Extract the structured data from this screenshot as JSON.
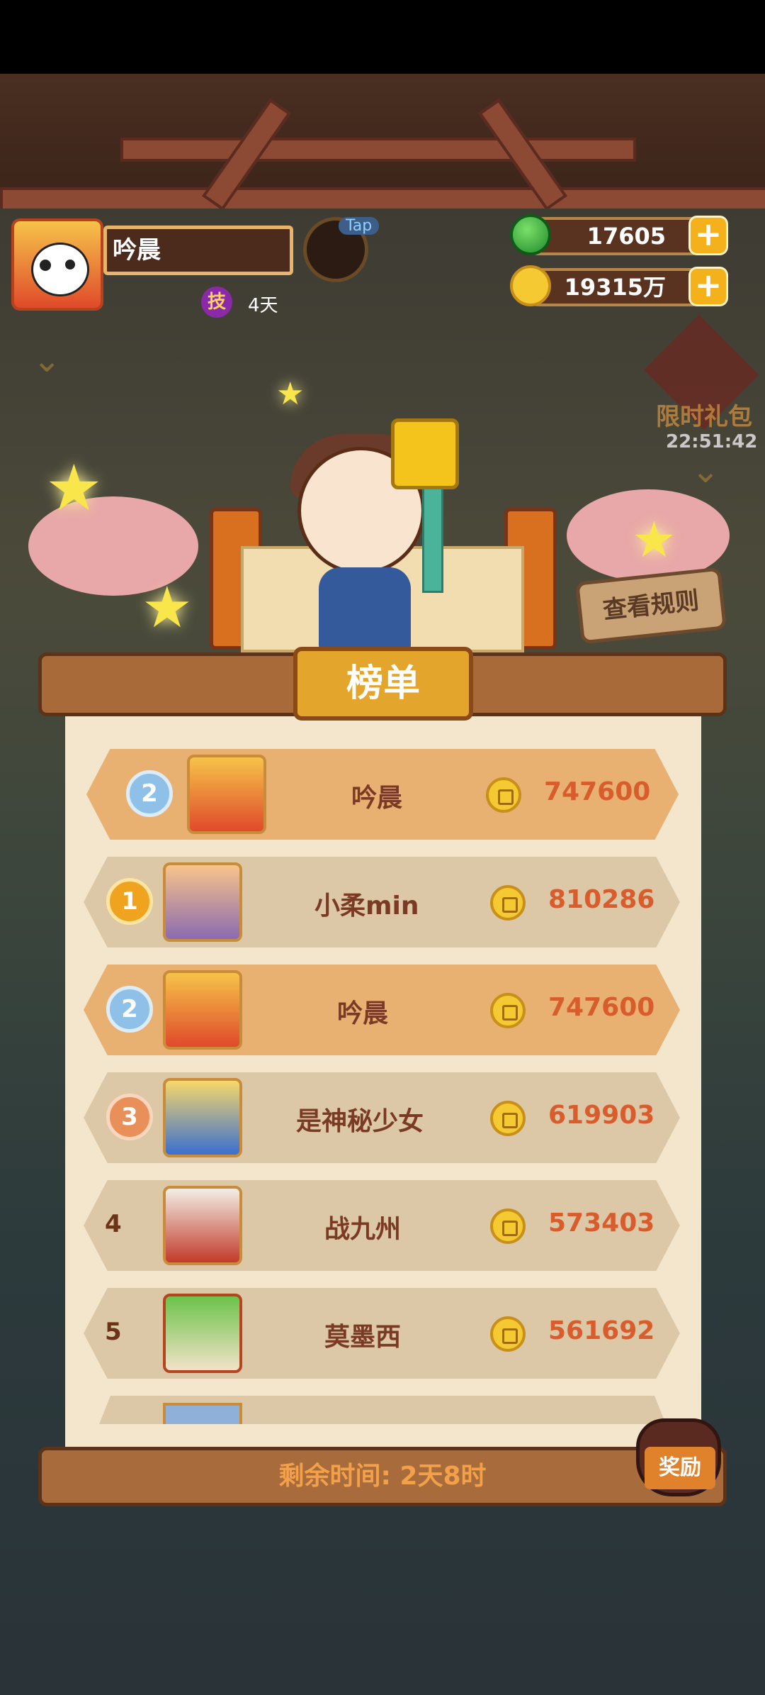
{
  "profile": {
    "name": "吟晨",
    "skill_badge": "技",
    "days": "4天",
    "tap_label": "Tap"
  },
  "currency": {
    "jade": "17605",
    "gold": "19315万",
    "plus": "+"
  },
  "gift": {
    "label": "限时礼包",
    "timer": "22:51:42"
  },
  "rules_button": "查看规则",
  "board": {
    "title": "榜单",
    "my_rank": {
      "rank": "2",
      "name": "吟晨",
      "score": "747600"
    },
    "rows": [
      {
        "rank": "1",
        "name": "小柔min",
        "score": "810286"
      },
      {
        "rank": "2",
        "name": "吟晨",
        "score": "747600"
      },
      {
        "rank": "3",
        "name": "是神秘少女",
        "score": "619903"
      },
      {
        "rank": "4",
        "name": "战九州",
        "score": "573403"
      },
      {
        "rank": "5",
        "name": "莫墨西",
        "score": "561692"
      }
    ],
    "time_left": "剩余时间: 2天8时"
  },
  "reward_button": "奖励",
  "colors": {
    "accent": "#e3a52c",
    "score": "#d85c2c",
    "highlight_row": "#e8b172",
    "row": "#dcc8a7"
  }
}
